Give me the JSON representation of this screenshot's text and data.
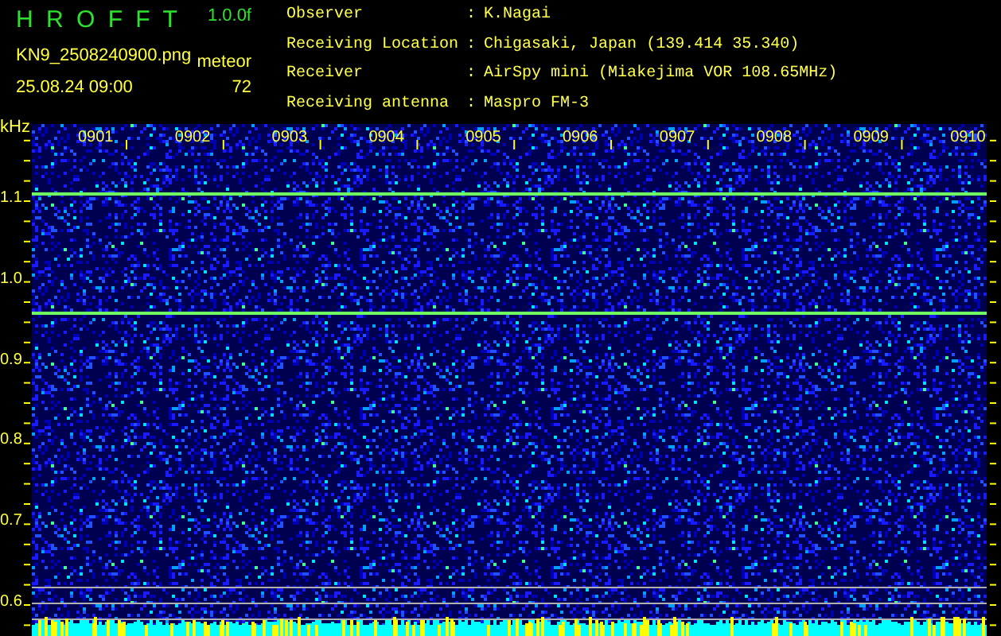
{
  "header": {
    "title": "H R O F F T",
    "version": "1.0.0f",
    "filename": "KN9_2508240900.png",
    "datetime": "25.08.24 09:00",
    "count_label": "meteor",
    "count": "72"
  },
  "info": [
    {
      "label": "Observer",
      "separator": ":",
      "value": "K.Nagai"
    },
    {
      "label": "Receiving Location",
      "separator": ":",
      "value": "Chigasaki, Japan (139.414 35.340)"
    },
    {
      "label": "Receiver",
      "separator": ":",
      "value": "AirSpy mini (Miakejima VOR 108.65MHz)"
    },
    {
      "label": "Receiving antenna",
      "separator": ":",
      "value": "Maspro FM-3"
    }
  ],
  "spectrogram": {
    "unit": "kHz",
    "y_labels": [
      "1.1",
      "1.0",
      "0.9",
      "0.8",
      "0.7",
      "0.6"
    ],
    "time_labels": [
      "0901",
      "0902",
      "0903",
      "0904",
      "0905",
      "0906",
      "0907",
      "0908",
      "0909",
      "0910"
    ]
  }
}
